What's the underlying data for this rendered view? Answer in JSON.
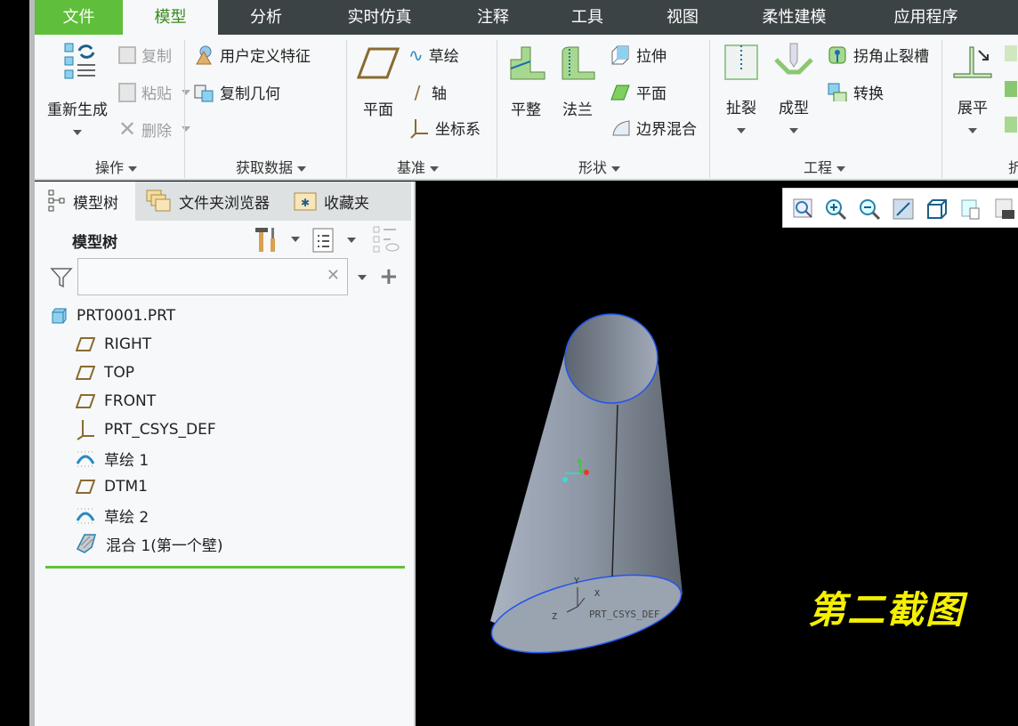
{
  "tabs": [
    {
      "label": "文件"
    },
    {
      "label": "模型"
    },
    {
      "label": "分析"
    },
    {
      "label": "实时仿真"
    },
    {
      "label": "注释"
    },
    {
      "label": "工具"
    },
    {
      "label": "视图"
    },
    {
      "label": "柔性建模"
    },
    {
      "label": "应用程序"
    }
  ],
  "active_tab": "模型",
  "colors": {
    "file_tab": "#5fbf3a",
    "active_tab_text": "#3a8a1e",
    "tabbar": "#3c4345",
    "caption": "#f5f000",
    "separator": "#5ec23c"
  },
  "ribbon": {
    "operations": {
      "label": "操作",
      "regenerate": "重新生成",
      "copy": "复制",
      "paste": "粘贴",
      "delete": "删除"
    },
    "get_data": {
      "label": "获取数据",
      "udf": "用户定义特征",
      "copy_geom": "复制几何"
    },
    "datum": {
      "label": "基准",
      "plane": "平面",
      "sketch": "草绘",
      "axis": "轴",
      "csys": "坐标系"
    },
    "shapes": {
      "label": "形状",
      "flat": "平整",
      "flange": "法兰",
      "extrude": "拉伸",
      "planar": "平面",
      "boundary_blend": "边界混合"
    },
    "engineering": {
      "label": "工程",
      "rip": "扯裂",
      "form": "成型",
      "corner_relief": "拐角止裂槽",
      "convert": "转换"
    },
    "bends": {
      "label": "折",
      "unbend": "展平"
    }
  },
  "panel": {
    "tabs": [
      {
        "label": "模型树"
      },
      {
        "label": "文件夹浏览器"
      },
      {
        "label": "收藏夹"
      }
    ],
    "title": "模型树",
    "filter": {
      "value": "",
      "placeholder": ""
    },
    "tree": [
      {
        "label": "PRT0001.PRT",
        "icon": "part-icon"
      },
      {
        "label": "RIGHT",
        "icon": "datum-plane-icon"
      },
      {
        "label": "TOP",
        "icon": "datum-plane-icon"
      },
      {
        "label": "FRONT",
        "icon": "datum-plane-icon"
      },
      {
        "label": "PRT_CSYS_DEF",
        "icon": "csys-icon"
      },
      {
        "label": "草绘 1",
        "icon": "sketch-icon"
      },
      {
        "label": "DTM1",
        "icon": "datum-plane-icon"
      },
      {
        "label": "草绘 2",
        "icon": "sketch-icon"
      },
      {
        "label": "混合 1(第一个壁)",
        "icon": "blend-wall-icon"
      }
    ]
  },
  "viewport": {
    "csys_label": "PRT_CSYS_DEF",
    "axis_x": "X",
    "axis_y": "Y",
    "axis_z": "Z",
    "caption": "第二截图"
  }
}
